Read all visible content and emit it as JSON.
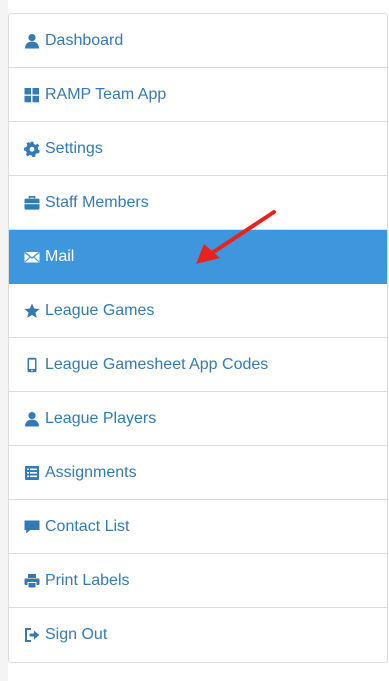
{
  "colors": {
    "link": "#337ab7",
    "active_bg": "#3e97dc",
    "active_text": "#ffffff",
    "annotation_arrow": "#e8231e"
  },
  "menu": {
    "items": [
      {
        "label": "Dashboard",
        "icon": "user-icon"
      },
      {
        "label": "RAMP Team App",
        "icon": "grid-icon"
      },
      {
        "label": "Settings",
        "icon": "gear-icon"
      },
      {
        "label": "Staff Members",
        "icon": "briefcase-icon"
      },
      {
        "label": "Mail",
        "icon": "envelope-icon",
        "active": true
      },
      {
        "label": "League Games",
        "icon": "star-icon"
      },
      {
        "label": "League Gamesheet App Codes",
        "icon": "mobile-icon"
      },
      {
        "label": "League Players",
        "icon": "user-icon"
      },
      {
        "label": "Assignments",
        "icon": "list-icon"
      },
      {
        "label": "Contact List",
        "icon": "comment-icon"
      },
      {
        "label": "Print Labels",
        "icon": "print-icon"
      },
      {
        "label": "Sign Out",
        "icon": "sign-out-icon"
      }
    ]
  }
}
